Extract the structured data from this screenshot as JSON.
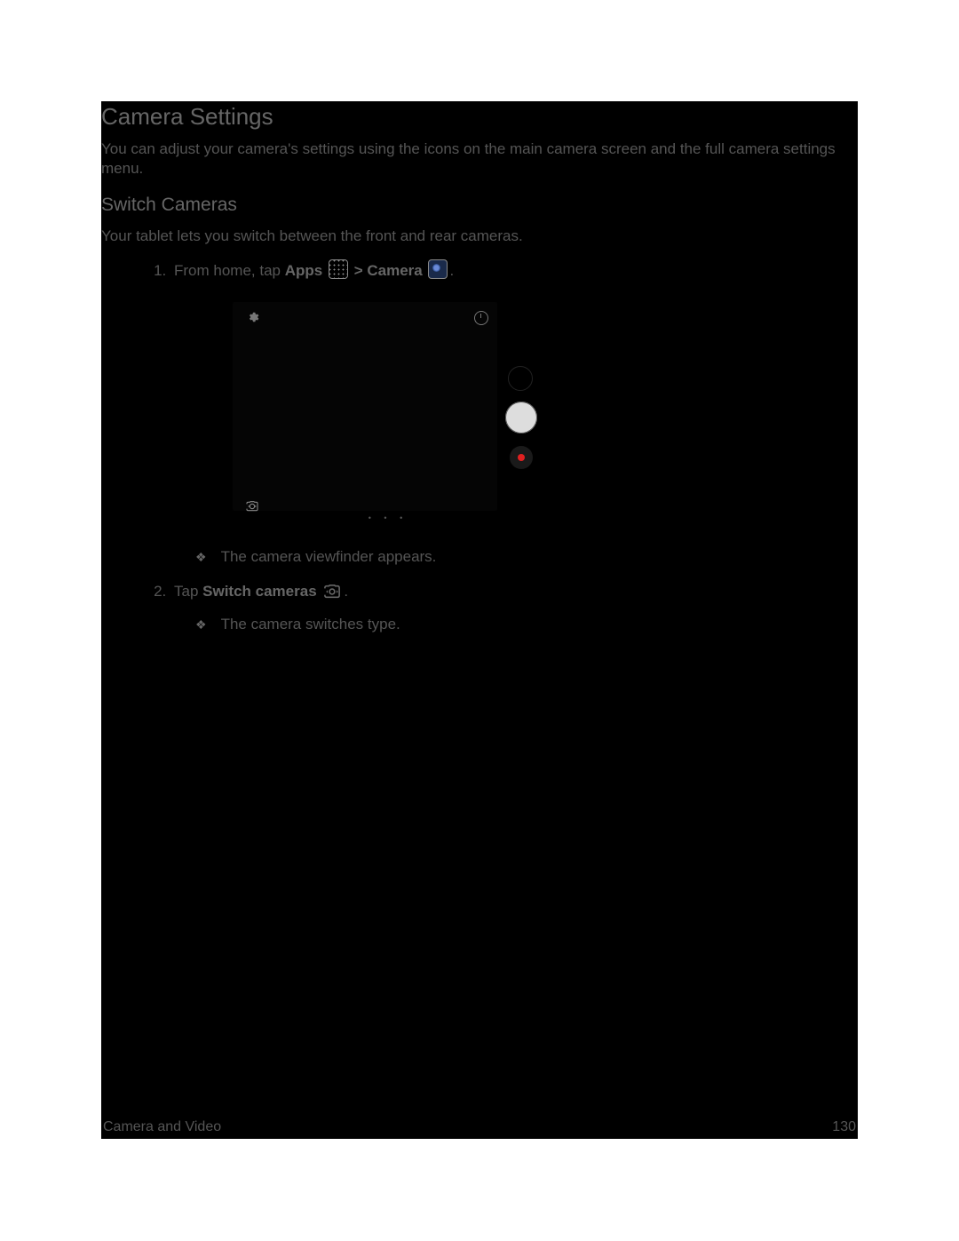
{
  "heading_main": "Camera Settings",
  "intro": "You can adjust your camera's settings using the icons on the main camera screen and the full camera settings menu.",
  "heading_sub": "Switch Cameras",
  "sub_intro": "Your tablet lets you switch between the front and rear cameras.",
  "step1_a": "From home, tap ",
  "step1_b": "Apps",
  "step1_c": " > ",
  "step1_d": "Camera",
  "step1_e": ".",
  "step1_result": "The camera viewfinder appears.",
  "step2_a": "Tap ",
  "step2_b": "Switch cameras",
  "step2_c": ".",
  "step2_result": "The camera switches type.",
  "footer_left": "Camera and Video",
  "footer_right": "130"
}
